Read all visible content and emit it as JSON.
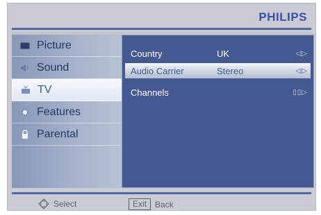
{
  "brand": {
    "name": "PHILIPS"
  },
  "menu": {
    "items": [
      {
        "label": "Picture",
        "icon": "picture-icon"
      },
      {
        "label": "Sound",
        "icon": "speaker-icon"
      },
      {
        "label": "TV",
        "icon": "tv-icon",
        "active": true
      },
      {
        "label": "Features",
        "icon": "gear-icon"
      },
      {
        "label": "Parental",
        "icon": "lock-icon"
      }
    ]
  },
  "settings": {
    "rows": [
      {
        "name": "Country",
        "value": "UK",
        "control": "◁▷"
      },
      {
        "name": "Audio Carrier",
        "value": "Stereo",
        "control": "◁▷",
        "selected": true
      },
      {
        "name": "Channels",
        "value": "",
        "control": "▯▯▷"
      }
    ]
  },
  "footer": {
    "select_label": "Select",
    "exit_key": "Exit",
    "back_label": "Back"
  },
  "colors": {
    "brand": "#3950a5",
    "menu_bg": "#a8b4cc",
    "content_bg": "#44598f",
    "selection": "#e0e7f3"
  }
}
